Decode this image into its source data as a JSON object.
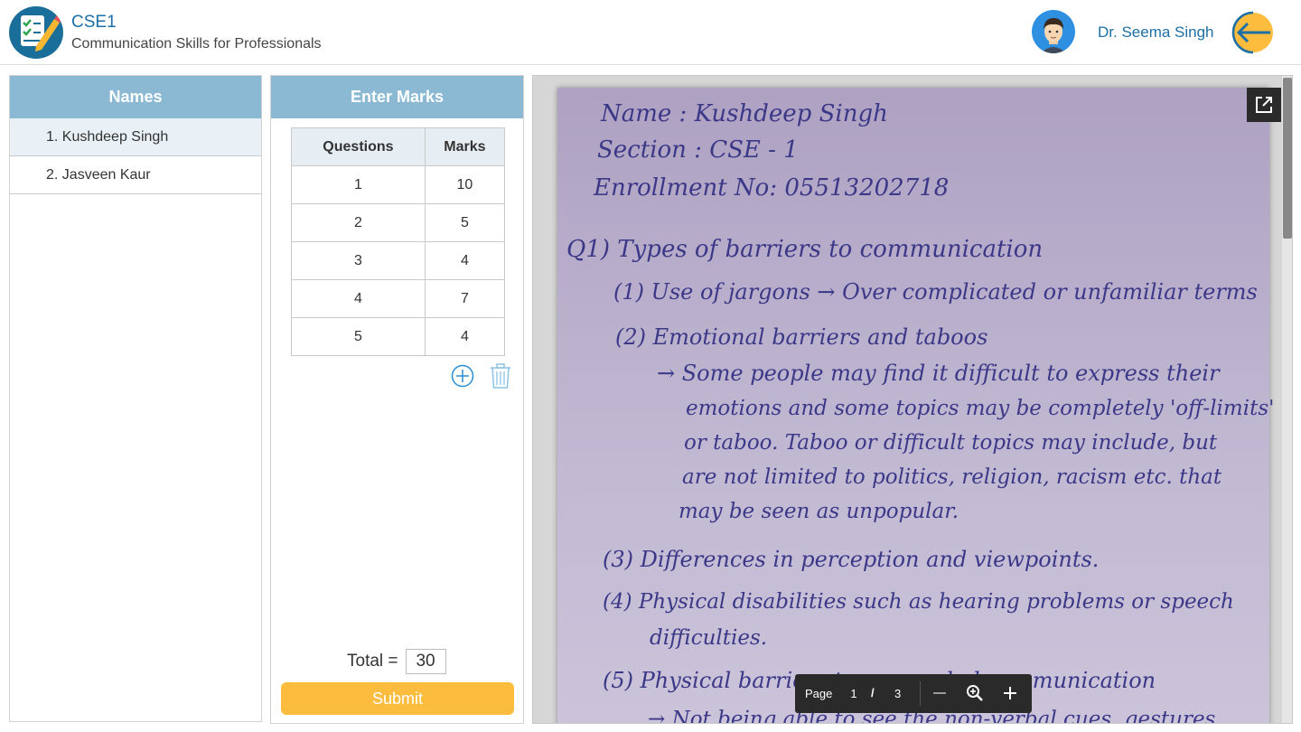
{
  "header": {
    "course_code": "CSE1",
    "course_name": "Communication Skills for Professionals",
    "user_name": "Dr. Seema Singh"
  },
  "names_panel": {
    "title": "Names",
    "items": [
      {
        "label": "1. Kushdeep Singh",
        "active": true
      },
      {
        "label": "2. Jasveen Kaur",
        "active": false
      }
    ]
  },
  "marks_panel": {
    "title": "Enter Marks",
    "columns": [
      "Questions",
      "Marks"
    ],
    "rows": [
      {
        "question": "1",
        "marks": "10"
      },
      {
        "question": "2",
        "marks": "5"
      },
      {
        "question": "3",
        "marks": "4"
      },
      {
        "question": "4",
        "marks": "7"
      },
      {
        "question": "5",
        "marks": "4"
      }
    ],
    "total_label": "Total =",
    "total_value": "30",
    "submit_label": "Submit"
  },
  "viewer": {
    "handwritten_lines": [
      "Name : Kushdeep Singh",
      "Section : CSE - 1",
      "Enrollment No: 05513202718",
      "Q1)  Types of barriers to communication",
      "(1)  Use of jargons → Over complicated or unfamiliar terms",
      "(2)  Emotional barriers and taboos",
      "→ Some people may find it difficult to express their",
      "emotions and some topics may be completely 'off-limits'",
      "or taboo. Taboo or difficult topics may include, but",
      "are not limited to politics, religion, racism etc. that",
      "may be seen as unpopular.",
      "(3)  Differences in perception and viewpoints.",
      "(4)  Physical disabilities such as hearing problems or speech",
      "difficulties.",
      "(5)  Physical barriers to non-verbal communication",
      "→ Not being able to see the non-verbal cues, gestures"
    ],
    "toolbar": {
      "page_label": "Page",
      "current_page": "1",
      "separator": "/",
      "total_pages": "3"
    }
  },
  "colors": {
    "panel_header": "#8bb9d3",
    "accent_blue": "#1d6fa5",
    "submit": "#fcbd3f",
    "ink": "#3c3888"
  },
  "icons": [
    "checklist-logo-icon",
    "user-avatar-icon",
    "back-arrow-icon",
    "add-circle-icon",
    "trash-icon",
    "popout-icon",
    "zoom-out-icon",
    "zoom-icon",
    "zoom-in-icon"
  ]
}
